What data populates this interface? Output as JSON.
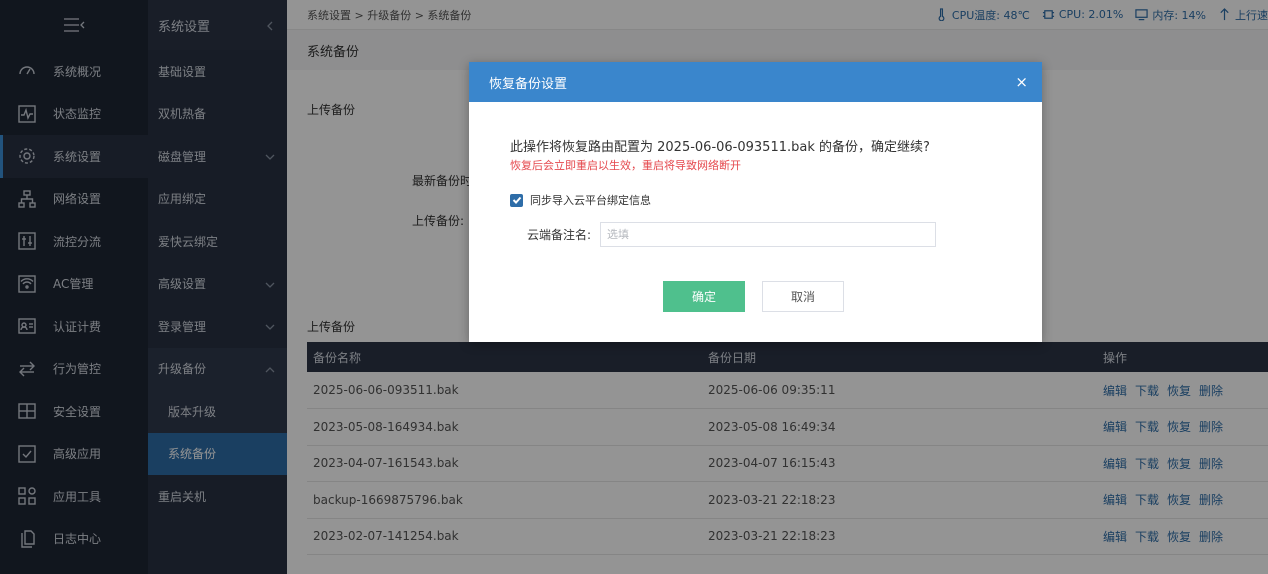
{
  "sidebar": {
    "items": [
      {
        "label": "系统概况",
        "icon": "gauge-icon"
      },
      {
        "label": "状态监控",
        "icon": "pulse-icon"
      },
      {
        "label": "系统设置",
        "icon": "gear-icon"
      },
      {
        "label": "网络设置",
        "icon": "network-icon"
      },
      {
        "label": "流控分流",
        "icon": "sliders-icon"
      },
      {
        "label": "AC管理",
        "icon": "ap-icon"
      },
      {
        "label": "认证计费",
        "icon": "id-card-icon"
      },
      {
        "label": "行为管控",
        "icon": "arrows-icon"
      },
      {
        "label": "安全设置",
        "icon": "grid-icon"
      },
      {
        "label": "高级应用",
        "icon": "check-box-icon"
      },
      {
        "label": "应用工具",
        "icon": "apps-icon"
      },
      {
        "label": "日志中心",
        "icon": "file-icon"
      }
    ]
  },
  "subnav": {
    "title": "系统设置",
    "items": [
      {
        "label": "基础设置"
      },
      {
        "label": "双机热备"
      },
      {
        "label": "磁盘管理"
      },
      {
        "label": "应用绑定"
      },
      {
        "label": "爱快云绑定"
      },
      {
        "label": "高级设置"
      },
      {
        "label": "登录管理"
      },
      {
        "label": "升级备份"
      },
      {
        "label": "版本升级"
      },
      {
        "label": "系统备份"
      },
      {
        "label": "重启关机"
      }
    ]
  },
  "breadcrumb": "系统设置 > 升级备份 > 系统备份",
  "status": {
    "cpu_temp": "CPU温度: 48℃",
    "cpu": "CPU: 2.01%",
    "mem": "内存: 14%",
    "upload": "上行速"
  },
  "page": {
    "title": "系统备份",
    "upload_section": "上传备份",
    "latest_label": "最新备份时",
    "upload_label": "上传备份:",
    "list_title": "上传备份"
  },
  "table": {
    "headers": [
      "备份名称",
      "备份日期",
      "操作"
    ],
    "actions": [
      "编辑",
      "下载",
      "恢复",
      "删除"
    ],
    "rows": [
      {
        "name": "2025-06-06-093511.bak",
        "date": "2025-06-06 09:35:11"
      },
      {
        "name": "2023-05-08-164934.bak",
        "date": "2023-05-08 16:49:34"
      },
      {
        "name": "2023-04-07-161543.bak",
        "date": "2023-04-07 16:15:43"
      },
      {
        "name": "backup-1669875796.bak",
        "date": "2023-03-21 22:18:23"
      },
      {
        "name": "2023-02-07-141254.bak",
        "date": "2023-03-21 22:18:23"
      }
    ]
  },
  "modal": {
    "title": "恢复备份设置",
    "close": "×",
    "message": "此操作将恢复路由配置为 2025-06-06-093511.bak 的备份，确定继续?",
    "warning": "恢复后会立即重启以生效，重启将导致网络断开",
    "checkbox_label": "同步导入云平台绑定信息",
    "checkbox_checked": true,
    "remark_label": "云端备注名:",
    "remark_placeholder": "选填",
    "remark_value": "",
    "ok_label": "确定",
    "cancel_label": "取消"
  },
  "colors": {
    "sidebar_bg": "#1e2634",
    "accent": "#3a86cc",
    "ok_button": "#4fc08d",
    "warning": "#e5484d"
  }
}
